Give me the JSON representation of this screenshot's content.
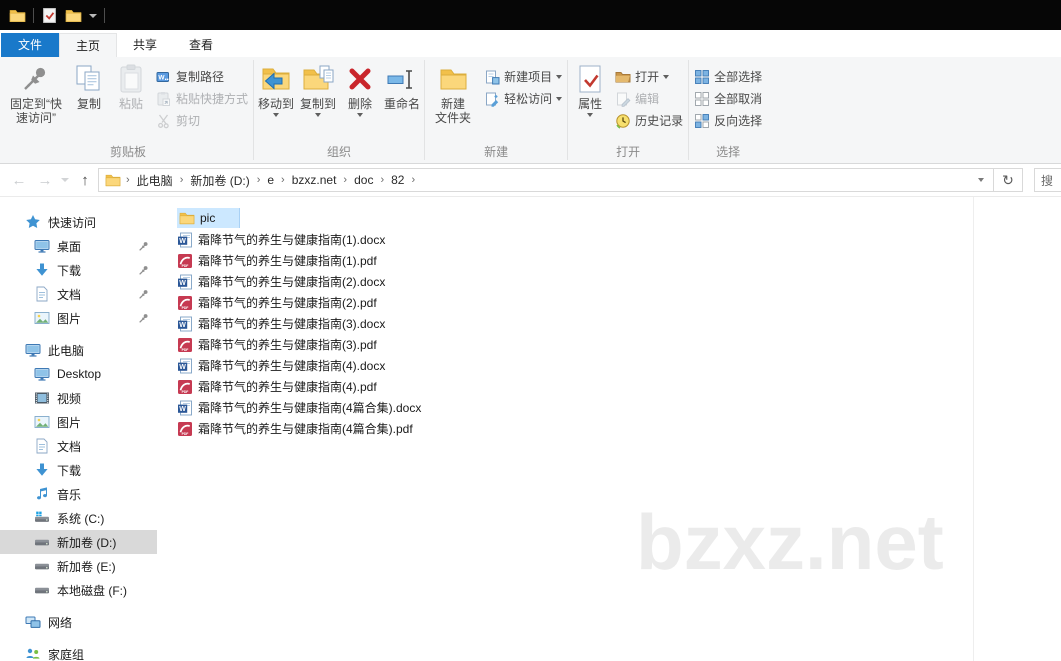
{
  "tabs": {
    "file": "文件",
    "home": "主页",
    "share": "共享",
    "view": "查看"
  },
  "ribbon": {
    "clipboard": {
      "label": "剪贴板",
      "pin_quick": "固定到“快\n速访问”",
      "copy": "复制",
      "paste": "粘贴",
      "copy_path": "复制路径",
      "paste_shortcut": "粘贴快捷方式",
      "cut": "剪切"
    },
    "organize": {
      "label": "组织",
      "move_to": "移动到",
      "copy_to": "复制到",
      "delete": "删除",
      "rename": "重命名"
    },
    "new": {
      "label": "新建",
      "new_folder": "新建\n文件夹",
      "new_item": "新建项目",
      "easy_access": "轻松访问"
    },
    "open": {
      "label": "打开",
      "properties": "属性",
      "open": "打开",
      "edit": "编辑",
      "history": "历史记录"
    },
    "select": {
      "label": "选择",
      "select_all": "全部选择",
      "select_none": "全部取消",
      "invert": "反向选择"
    }
  },
  "address": {
    "crumbs": [
      "此电脑",
      "新加卷 (D:)",
      "e",
      "bzxz.net",
      "doc",
      "82"
    ],
    "search_hint": "搜"
  },
  "nav_icons": {
    "back": "←",
    "forward": "→",
    "up": "↑",
    "refresh": "↻"
  },
  "sidebar": {
    "quick_access": {
      "label": "快速访问",
      "items": [
        {
          "label": "桌面"
        },
        {
          "label": "下载"
        },
        {
          "label": "文档"
        },
        {
          "label": "图片"
        }
      ]
    },
    "this_pc": {
      "label": "此电脑",
      "items": [
        {
          "label": "Desktop"
        },
        {
          "label": "视频"
        },
        {
          "label": "图片"
        },
        {
          "label": "文档"
        },
        {
          "label": "下载"
        },
        {
          "label": "音乐"
        },
        {
          "label": "系统 (C:)"
        },
        {
          "label": "新加卷 (D:)"
        },
        {
          "label": "新加卷 (E:)"
        },
        {
          "label": "本地磁盘 (F:)"
        }
      ]
    },
    "network": {
      "label": "网络"
    },
    "homegroup": {
      "label": "家庭组"
    },
    "selected_item": "新加卷 (D:)"
  },
  "files": {
    "rows": [
      {
        "name": "pic",
        "type": "folder",
        "selected": true
      },
      {
        "name": "霜降节气的养生与健康指南(1).docx",
        "type": "docx"
      },
      {
        "name": "霜降节气的养生与健康指南(1).pdf",
        "type": "pdf"
      },
      {
        "name": "霜降节气的养生与健康指南(2).docx",
        "type": "docx"
      },
      {
        "name": "霜降节气的养生与健康指南(2).pdf",
        "type": "pdf"
      },
      {
        "name": "霜降节气的养生与健康指南(3).docx",
        "type": "docx"
      },
      {
        "name": "霜降节气的养生与健康指南(3).pdf",
        "type": "pdf"
      },
      {
        "name": "霜降节气的养生与健康指南(4).docx",
        "type": "docx"
      },
      {
        "name": "霜降节气的养生与健康指南(4).pdf",
        "type": "pdf"
      },
      {
        "name": "霜降节气的养生与健康指南(4篇合集).docx",
        "type": "docx"
      },
      {
        "name": "霜降节气的养生与健康指南(4篇合集).pdf",
        "type": "pdf"
      }
    ]
  },
  "watermark": "bzxz.net",
  "colors": {
    "accent_blue": "#1979ca",
    "titlebar": "#060606",
    "ribbon_bg": "#f5f6f7",
    "file_selection": "#cce8ff",
    "sidebar_selection": "#d9d9d9",
    "folder_yellow": "#fbd77b",
    "pdf_red": "#c63a52",
    "word_blue": "#2b5797",
    "watermark_gray": "#ebebeb"
  }
}
